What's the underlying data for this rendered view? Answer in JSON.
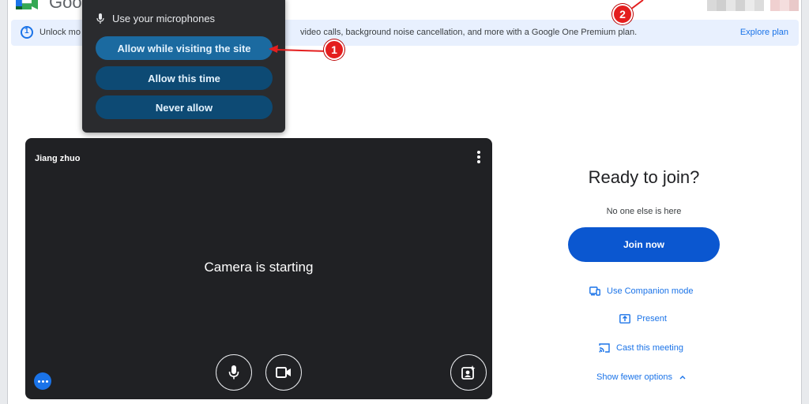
{
  "app": {
    "logo_text": "Goo"
  },
  "banner": {
    "text_left": "Unlock mo",
    "text_right": "video calls, background noise cancellation, and more with a Google One Premium plan.",
    "link": "Explore plan"
  },
  "permission_popup": {
    "mic_label": "Use your microphones",
    "buttons": [
      "Allow while visiting the site",
      "Allow this time",
      "Never allow"
    ]
  },
  "annotations": [
    {
      "label": "1"
    },
    {
      "label": "2"
    }
  ],
  "video": {
    "participant_name": "Jiang zhuo",
    "status": "Camera is starting"
  },
  "join_panel": {
    "title": "Ready to join?",
    "subtitle": "No one else is here",
    "join_button": "Join now",
    "options": [
      {
        "label": "Use Companion mode",
        "icon": "companion-icon"
      },
      {
        "label": "Present",
        "icon": "present-icon"
      },
      {
        "label": "Cast this meeting",
        "icon": "cast-icon"
      },
      {
        "label": "Show fewer options",
        "icon": "chevron-up-icon"
      }
    ]
  },
  "colors": {
    "accent": "#1a73e8",
    "join_button": "#0b57d0",
    "marker": "#e41e1e",
    "popup_bg": "#2a2b2e"
  }
}
